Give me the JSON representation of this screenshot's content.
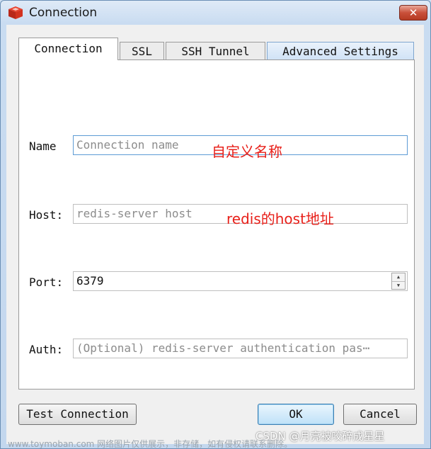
{
  "window": {
    "title": "Connection",
    "close_label": "✕"
  },
  "tabs": [
    {
      "label": "Connection",
      "active": true
    },
    {
      "label": "SSL",
      "active": false
    },
    {
      "label": "SSH Tunnel",
      "active": false
    },
    {
      "label": "Advanced Settings",
      "active": false
    }
  ],
  "form": {
    "name_label": "Name",
    "name_placeholder": "Connection name",
    "name_annotation": "自定义名称",
    "host_label": "Host:",
    "host_placeholder": "redis-server host",
    "host_annotation": "redis的host地址",
    "port_label": "Port:",
    "port_value": "6379",
    "auth_label": "Auth:",
    "auth_placeholder": "(Optional) redis-server authentication pas⋯"
  },
  "buttons": {
    "test_connection": "Test Connection",
    "ok": "OK",
    "cancel": "Cancel"
  },
  "watermark": {
    "left": "www.toymoban.com 网络图片仅供展示，非存储，如有侵权请联系删除。",
    "right": "CSDN @月亮被咬碎成星星"
  },
  "colors": {
    "annotation": "#e8201a",
    "title_bar": "#c9dcf1",
    "close_button": "#c9503a"
  },
  "icons": {
    "app": "redis-cube-icon",
    "spinner": "spin-arrows-icon"
  }
}
